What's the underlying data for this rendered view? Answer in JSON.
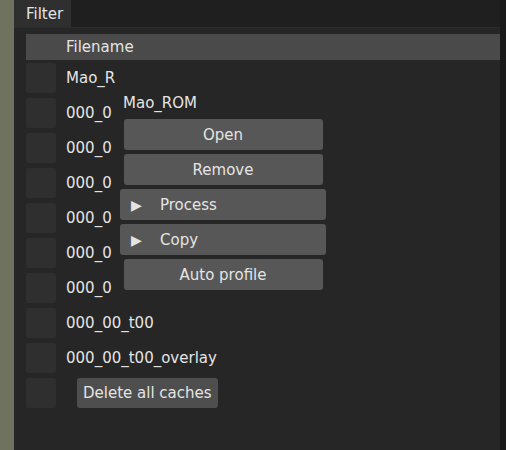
{
  "filter": {
    "label": "Filter"
  },
  "table": {
    "columns": [
      "Filename"
    ],
    "rows": [
      {
        "name": "Mao_R",
        "checked": false
      },
      {
        "name": "000_0",
        "checked": false
      },
      {
        "name": "000_0",
        "checked": false
      },
      {
        "name": "000_0",
        "checked": false
      },
      {
        "name": "000_0",
        "checked": false
      },
      {
        "name": "000_0",
        "checked": false
      },
      {
        "name": "000_0",
        "checked": false
      },
      {
        "name": "000_00_t00",
        "checked": false
      },
      {
        "name": "000_00_t00_overlay",
        "checked": false
      }
    ]
  },
  "footer": {
    "checked": false,
    "button": "Delete all caches"
  },
  "context_menu": {
    "title": "Mao_ROM",
    "items": [
      {
        "label": "Open",
        "kind": "button"
      },
      {
        "label": "Remove",
        "kind": "button"
      },
      {
        "label": "Process",
        "kind": "submenu",
        "icon": "▶"
      },
      {
        "label": "Copy",
        "kind": "submenu",
        "icon": "▶"
      },
      {
        "label": "Auto profile",
        "kind": "button"
      }
    ]
  }
}
